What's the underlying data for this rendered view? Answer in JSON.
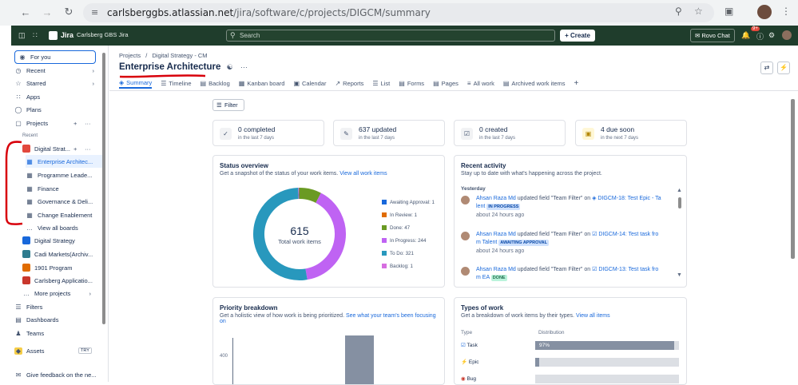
{
  "browser": {
    "url_host": "carlsberggbs.atlassian.net",
    "url_path": "/jira/software/c/projects/DIGCM/summary"
  },
  "topbar": {
    "product": "Jira",
    "site": "Carlsberg GBS Jira",
    "search_placeholder": "Search",
    "create_label": "Create",
    "rovo_label": "Rovo Chat",
    "notif_badge": "9+"
  },
  "sidebar": {
    "for_you": "For you",
    "recent": "Recent",
    "starred": "Starred",
    "apps": "Apps",
    "plans": "Plans",
    "projects": "Projects",
    "recent_header": "Recent",
    "recent_project": "Digital Strat...",
    "boards": [
      "Enterprise Architec...",
      "Programme Leade...",
      "Finance",
      "Governance & Deli...",
      "Change Enablement"
    ],
    "view_all_boards": "View all boards",
    "projects_list": [
      "Digital Strategy",
      "Cadi Markets(Archiv...",
      "1901 Program",
      "Carlsberg Applicatio..."
    ],
    "more_projects": "More projects",
    "filters": "Filters",
    "dashboards": "Dashboards",
    "teams": "Teams",
    "assets": "Assets",
    "assets_badge": "TRY",
    "feedback": "Give feedback on the ne..."
  },
  "page": {
    "breadcrumb_projects": "Projects",
    "breadcrumb_sep": "/",
    "breadcrumb_project": "Digital Strategy - CM",
    "title": "Enterprise Architecture",
    "more": "···",
    "tabs": [
      "Summary",
      "Timeline",
      "Backlog",
      "Kanban board",
      "Calendar",
      "Reports",
      "List",
      "Forms",
      "Pages",
      "All work",
      "Archived work items"
    ],
    "add_tab": "+",
    "filter_label": "Filter"
  },
  "stats": [
    {
      "value": "0 completed",
      "sub": "in the last 7 days"
    },
    {
      "value": "637 updated",
      "sub": "in the last 7 days"
    },
    {
      "value": "0 created",
      "sub": "in the last 7 days"
    },
    {
      "value": "4 due soon",
      "sub": "in the next 7 days"
    }
  ],
  "status_overview": {
    "title": "Status overview",
    "subtitle": "Get a snapshot of the status of your work items.",
    "link": "View all work items",
    "total": "615",
    "total_label": "Total work items",
    "legend": [
      "Awaiting Approval: 1",
      "In Review: 1",
      "Done: 47",
      "In Progress: 244",
      "To Do: 321",
      "Backlog: 1"
    ]
  },
  "chart_data": {
    "type": "pie",
    "categories": [
      "Awaiting Approval",
      "In Review",
      "Done",
      "In Progress",
      "To Do",
      "Backlog"
    ],
    "values": [
      1,
      1,
      47,
      244,
      321,
      1
    ],
    "colors": [
      "#1868db",
      "#e06c00",
      "#6a9a23",
      "#bf63f3",
      "#2898bd",
      "#d66ee0"
    ]
  },
  "recent_activity": {
    "title": "Recent activity",
    "subtitle": "Stay up to date with what's happening across the project.",
    "day": "Yesterday",
    "items": [
      {
        "user": "Ahsan Raza Md",
        "text": "updated field \"Team Filter\" on",
        "issue": "DIGCM-18: Test Epic - Ta",
        "issue2": "lent",
        "status": "IN PROGRESS",
        "ago": "about 24 hours ago"
      },
      {
        "user": "Ahsan Raza Md",
        "text": "updated field \"Team Filter\" on",
        "issue": "DIGCM-14: Test task fro",
        "issue2": "m Talent",
        "status": "AWAITING APPROVAL",
        "ago": "about 24 hours ago"
      },
      {
        "user": "Ahsan Raza Md",
        "text": "updated field \"Team Filter\" on",
        "issue": "DIGCM-13: Test task fro",
        "issue2": "m EA",
        "status": "DONE",
        "ago": ""
      }
    ]
  },
  "priority": {
    "title": "Priority breakdown",
    "subtitle": "Get a holistic view of how work is being prioritized.",
    "link": "See what your team's been focusing on",
    "tick": "400"
  },
  "types": {
    "title": "Types of work",
    "subtitle": "Get a breakdown of work items by their types.",
    "link": "View all items",
    "col_type": "Type",
    "col_dist": "Distribution",
    "rows": [
      {
        "name": "Task",
        "pct": "97%",
        "frac": 0.97
      },
      {
        "name": "Epic",
        "pct": "",
        "frac": 0.03
      },
      {
        "name": "Bug",
        "pct": "",
        "frac": 0.0
      }
    ]
  }
}
